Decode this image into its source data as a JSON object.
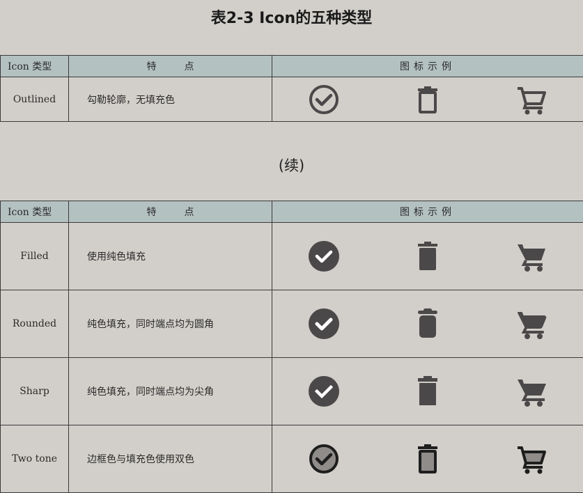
{
  "title": "表2-3 Icon的五种类型",
  "continued": "(续)",
  "header": {
    "type": "Icon 类型",
    "feature": "特点",
    "examples": "图标示例"
  },
  "rows": [
    {
      "type": "Outlined",
      "feature": "勾勒轮廓，无填充色"
    },
    {
      "type": "Filled",
      "feature": "使用纯色填充"
    },
    {
      "type": "Rounded",
      "feature": "纯色填充，同时端点均为圆角"
    },
    {
      "type": "Sharp",
      "feature": "纯色填充，同时端点均为尖角"
    },
    {
      "type": "Two tone",
      "feature": "边框色与填充色使用双色"
    }
  ],
  "icons": [
    "check-circle-icon",
    "trash-icon",
    "shopping-cart-icon"
  ],
  "colors": {
    "header_bg": "#b4c1c1",
    "page_bg": "#d2cfca",
    "icon": "#4a4848",
    "twotone_fill": "#8f8c8a"
  }
}
